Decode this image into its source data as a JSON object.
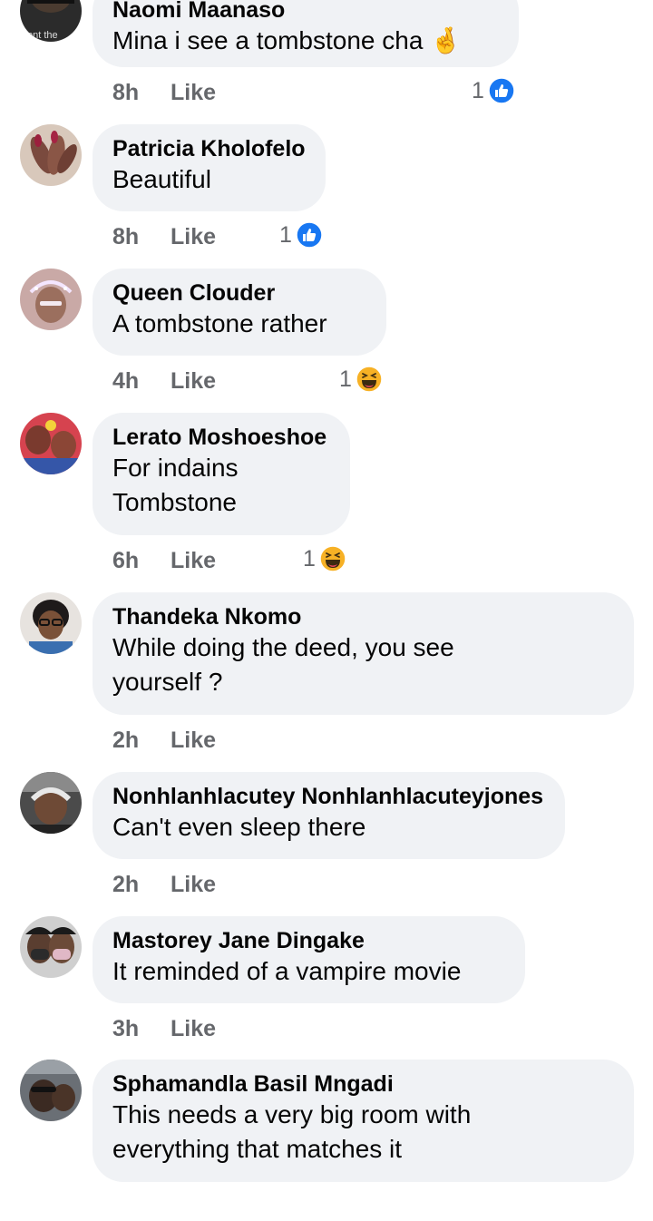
{
  "comments": [
    {
      "author": "Naomi Maanaso",
      "text": "Mina i see a tombstone cha 🤞",
      "time": "8h",
      "like_label": "Like",
      "reaction_count": "1",
      "reaction_icon": "like-icon",
      "avatar_text": "ont the"
    },
    {
      "author": "Patricia Kholofelo",
      "text": "Beautiful",
      "time": "8h",
      "like_label": "Like",
      "reaction_count": "1",
      "reaction_icon": "like-icon"
    },
    {
      "author": "Queen Clouder",
      "text": "A tombstone rather",
      "time": "4h",
      "like_label": "Like",
      "reaction_count": "1",
      "reaction_icon": "haha-icon"
    },
    {
      "author": "Lerato Moshoeshoe",
      "text": "For indains\nTombstone",
      "time": "6h",
      "like_label": "Like",
      "reaction_count": "1",
      "reaction_icon": "haha-icon"
    },
    {
      "author": "Thandeka Nkomo",
      "text": "While doing the deed,  you see\nyourself ?",
      "time": "2h",
      "like_label": "Like"
    },
    {
      "author": "Nonhlanhlacutey Nonhlanhlacuteyjones",
      "text": "Can't even sleep there",
      "time": "2h",
      "like_label": "Like"
    },
    {
      "author": "Mastorey Jane Dingake",
      "text": "It reminded of a vampire movie",
      "time": "3h",
      "like_label": "Like"
    },
    {
      "author": "Sphamandla Basil Mngadi",
      "text": "This needs a very big room with\neverything that matches it",
      "time": "",
      "like_label": ""
    }
  ],
  "colors": {
    "bubble": "#f0f2f5",
    "meta_text": "#65676b",
    "like_blue": "#1877f2",
    "haha_yellow": "#f7b125"
  }
}
